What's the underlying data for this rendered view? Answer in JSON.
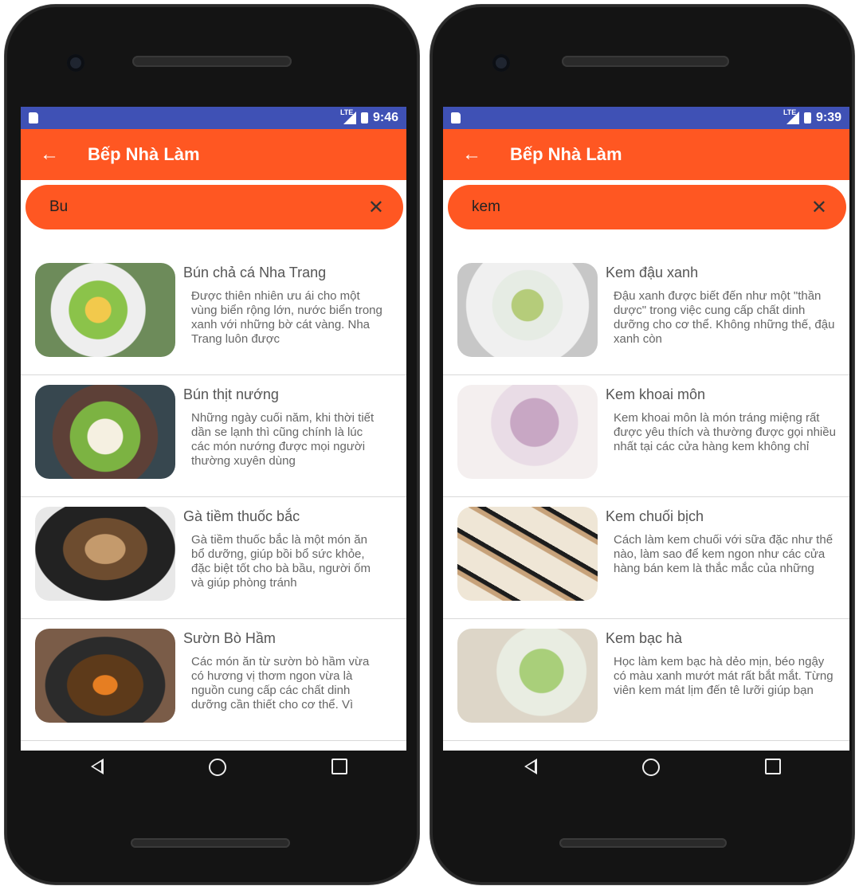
{
  "phones": [
    {
      "status": {
        "time": "9:46",
        "network": "LTE"
      },
      "appbar": {
        "title": "Bếp Nhà Làm"
      },
      "search": {
        "value": "Bu"
      },
      "items": [
        {
          "name": "Bún chả cá Nha Trang",
          "desc": "Được thiên nhiên ưu ái cho một vùng biển rộng lớn, nước biển trong xanh với những bờ cát vàng. Nha Trang luôn được"
        },
        {
          "name": "Bún thịt nướng",
          "desc": "Những ngày cuối năm, khi thời tiết dần se lạnh thì cũng chính là lúc các món nướng được mọi người thường xuyên dùng"
        },
        {
          "name": "Gà tiềm thuốc bắc",
          "desc": "Gà tiềm thuốc bắc là một món ăn bổ dưỡng, giúp bồi bổ sức khỏe, đặc biệt tốt cho bà bầu, người ốm và giúp phòng tránh"
        },
        {
          "name": "Sườn Bò Hầm",
          "desc": "Các món ăn từ sườn bò hầm vừa có hương vị thơm ngon vừa là nguồn cung cấp các chất dinh dưỡng cần thiết cho cơ thể. Vì"
        }
      ]
    },
    {
      "status": {
        "time": "9:39",
        "network": "LTE"
      },
      "appbar": {
        "title": "Bếp Nhà Làm"
      },
      "search": {
        "value": "kem"
      },
      "items": [
        {
          "name": "Kem đậu xanh",
          "desc": "Đậu xanh được biết đến như một \"thần dược\" trong việc cung cấp chất dinh dưỡng cho cơ thể. Không những thế, đậu xanh còn"
        },
        {
          "name": "Kem khoai môn",
          "desc": "Kem khoai môn là món tráng miệng rất được yêu thích và thường được gọi nhiều nhất tại các cửa hàng kem không chỉ"
        },
        {
          "name": "Kem chuối bịch",
          "desc": "Cách làm kem chuối với sữa đặc như thế nào, làm sao để kem ngon như các cửa hàng bán kem là thắc mắc của những"
        },
        {
          "name": "Kem bạc hà",
          "desc": "Học làm kem bạc hà dẻo mịn, béo ngậy có màu xanh mướt mát rất bắt mắt. Từng viên kem mát lịm đến tê lưỡi giúp bạn"
        }
      ]
    }
  ],
  "colors": {
    "accent": "#ff5722",
    "statusbar": "#3f51b5"
  }
}
